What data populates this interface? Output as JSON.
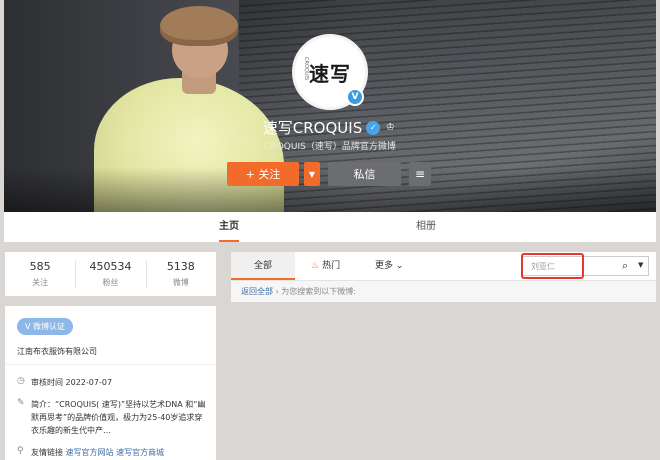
{
  "profile": {
    "avatar_text": "速写",
    "avatar_side_text": "CROQUIS",
    "name": "速写CROQUIS",
    "description": "CROQUIS（速写）品牌官方微博"
  },
  "actions": {
    "follow_label": "+ 关注",
    "follow_menu": "▼",
    "message_label": "私信",
    "menu_icon": "≡"
  },
  "tabs": [
    {
      "label": "主页"
    },
    {
      "label": "相册"
    }
  ],
  "stats": [
    {
      "value": "585",
      "label": "关注"
    },
    {
      "value": "450534",
      "label": "粉丝"
    },
    {
      "value": "5138",
      "label": "微博"
    }
  ],
  "info": {
    "cert_label": "微博认证",
    "company": "江南布衣服饰有限公司",
    "review_time": "审核时间 2022-07-07",
    "intro": "简介：“CROQUIS( 速写)”坚持以艺术DNA 和“幽默再思考”的品牌价值观，极力为25-40岁追求穿衣乐趣的新生代中产…",
    "links_prefix": "友情链接",
    "link1": "速写官方网站",
    "link2": "速写官方商城"
  },
  "feed": {
    "tab_all": "全部",
    "tab_hot": "热门",
    "tab_more": "更多",
    "search_value": "刘亚仁",
    "back_label": "返回全部",
    "result_text": "为您搜索到以下微博:"
  },
  "colors": {
    "accent": "#f26b2b",
    "highlight": "#e23a2e",
    "link": "#3b6ea5",
    "verified": "#3f9be0"
  },
  "icons": {
    "fire": "fire-icon",
    "search": "search-icon",
    "clock": "clock-icon",
    "edit": "edit-icon",
    "link": "link-icon"
  }
}
